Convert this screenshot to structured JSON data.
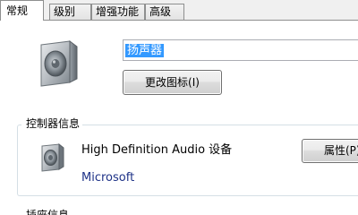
{
  "tabs": [
    {
      "label": "常规",
      "selected": true
    },
    {
      "label": "级别",
      "selected": false
    },
    {
      "label": "增强功能",
      "selected": false
    },
    {
      "label": "高级",
      "selected": false
    }
  ],
  "general": {
    "device_name_value": "扬声器",
    "change_icon_button": "更改图标(I)",
    "icon": "speaker-icon"
  },
  "controller_info": {
    "title": "控制器信息",
    "device_name": "High Definition Audio 设备",
    "manufacturer": "Microsoft",
    "properties_button": "属性(P)",
    "icon": "speaker-icon"
  },
  "next_section": {
    "title": "插座信息"
  },
  "colors": {
    "selection": "#3399ff",
    "manufacturer_text": "#1e3287",
    "groupbox_border": "#d5dfe5"
  }
}
